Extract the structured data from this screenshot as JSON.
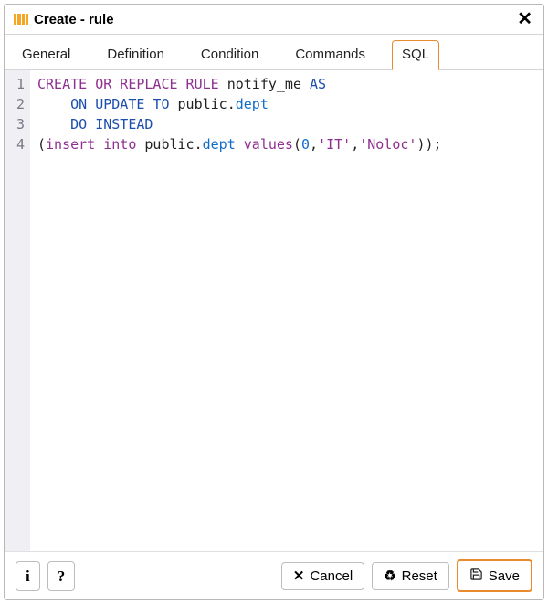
{
  "title": "Create - rule",
  "tabs": [
    "General",
    "Definition",
    "Condition",
    "Commands",
    "SQL"
  ],
  "activeTab": "SQL",
  "code": {
    "lines": [
      {
        "n": "1",
        "tokens": [
          {
            "t": "CREATE OR REPLACE RULE ",
            "c": "k1"
          },
          {
            "t": "notify_me ",
            "c": "id"
          },
          {
            "t": "AS",
            "c": "kw2"
          }
        ]
      },
      {
        "n": "2",
        "tokens": [
          {
            "t": "    ",
            "c": ""
          },
          {
            "t": "ON UPDATE TO ",
            "c": "kw2"
          },
          {
            "t": "public",
            "c": "id"
          },
          {
            "t": ".",
            "c": "dot"
          },
          {
            "t": "dept",
            "c": "tbl"
          }
        ]
      },
      {
        "n": "3",
        "tokens": [
          {
            "t": "    ",
            "c": ""
          },
          {
            "t": "DO INSTEAD",
            "c": "kw2"
          }
        ]
      },
      {
        "n": "4",
        "tokens": [
          {
            "t": "(",
            "c": "paren"
          },
          {
            "t": "insert into ",
            "c": "k1"
          },
          {
            "t": "public",
            "c": "id"
          },
          {
            "t": ".",
            "c": "dot"
          },
          {
            "t": "dept",
            "c": "tbl"
          },
          {
            "t": " ",
            "c": ""
          },
          {
            "t": "values",
            "c": "k1"
          },
          {
            "t": "(",
            "c": "paren"
          },
          {
            "t": "0",
            "c": "num"
          },
          {
            "t": ",",
            "c": "paren"
          },
          {
            "t": "'IT'",
            "c": "str"
          },
          {
            "t": ",",
            "c": "paren"
          },
          {
            "t": "'Noloc'",
            "c": "str"
          },
          {
            "t": "));",
            "c": "paren"
          }
        ]
      }
    ]
  },
  "footer": {
    "info_label": "i",
    "help_label": "?",
    "cancel_label": "Cancel",
    "reset_label": "Reset",
    "save_label": "Save"
  }
}
